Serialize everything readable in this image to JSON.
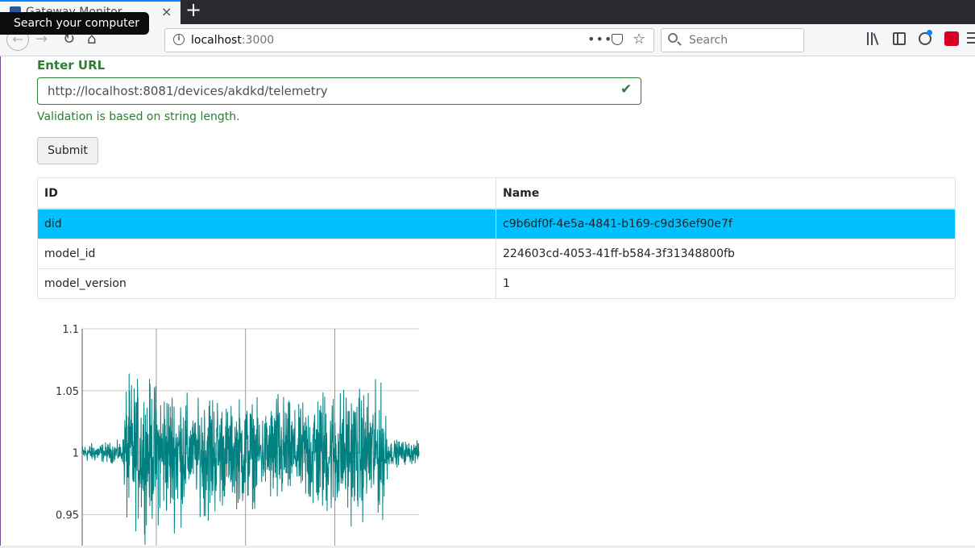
{
  "browser": {
    "tab_title": "Gateway Monitor",
    "tab_close": "×",
    "new_tab": "+",
    "tooltip": "Search your computer",
    "url_host": "localhost",
    "url_port": ":3000",
    "search_placeholder": "Search",
    "icons": [
      "back-icon",
      "forward-icon",
      "reload-icon",
      "home-icon",
      "info-icon",
      "more-icon",
      "pocket-icon",
      "star-icon",
      "search-icon",
      "library-icon",
      "sidebar-icon",
      "account-icon",
      "addon-icon",
      "menu-icon"
    ]
  },
  "form": {
    "label": "Enter URL",
    "url_value": "http://localhost:8081/devices/akdkd/telemetry",
    "feedback": "Validation is based on string length.",
    "submit_label": "Submit"
  },
  "table": {
    "headers": [
      "ID",
      "Name"
    ],
    "rows": [
      {
        "id": "did",
        "name": "c9b6df0f-4e5a-4841-b169-c9d36ef90e7f",
        "selected": true
      },
      {
        "id": "model_id",
        "name": "224603cd-4053-41ff-b584-3f31348800fb",
        "selected": false
      },
      {
        "id": "model_version",
        "name": "1",
        "selected": false
      }
    ],
    "selected_color": "#00bfff"
  },
  "chart_data": {
    "type": "line",
    "title": "",
    "xlabel": "",
    "ylabel": "",
    "ylim": [
      0.925,
      1.1
    ],
    "yticks": [
      1.1,
      1.05,
      1,
      0.95
    ],
    "ytick_labels": [
      "1.1",
      "1.05",
      "1",
      "0.95"
    ],
    "grid": true,
    "series_color": "#008080",
    "envelope": [
      {
        "x": 0.0,
        "amp": 0.01
      },
      {
        "x": 0.12,
        "amp": 0.012
      },
      {
        "x": 0.13,
        "amp": 0.08
      },
      {
        "x": 0.3,
        "amp": 0.075
      },
      {
        "x": 0.33,
        "amp": 0.04
      },
      {
        "x": 0.37,
        "amp": 0.08
      },
      {
        "x": 0.44,
        "amp": 0.05
      },
      {
        "x": 0.48,
        "amp": 0.065
      },
      {
        "x": 0.54,
        "amp": 0.045
      },
      {
        "x": 0.58,
        "amp": 0.07
      },
      {
        "x": 0.64,
        "amp": 0.045
      },
      {
        "x": 0.68,
        "amp": 0.072
      },
      {
        "x": 0.9,
        "amp": 0.07
      },
      {
        "x": 0.91,
        "amp": 0.015
      },
      {
        "x": 1.0,
        "amp": 0.012
      }
    ]
  }
}
